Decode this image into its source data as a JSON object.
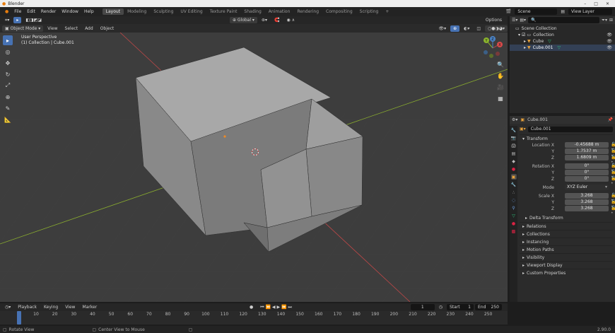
{
  "window": {
    "title": "Blender"
  },
  "menu": [
    "File",
    "Edit",
    "Render",
    "Window",
    "Help"
  ],
  "workspaces": [
    {
      "label": "Layout",
      "active": true
    },
    {
      "label": "Modeling",
      "active": false
    },
    {
      "label": "Sculpting",
      "active": false
    },
    {
      "label": "UV Editing",
      "active": false
    },
    {
      "label": "Texture Paint",
      "active": false
    },
    {
      "label": "Shading",
      "active": false
    },
    {
      "label": "Animation",
      "active": false
    },
    {
      "label": "Rendering",
      "active": false
    },
    {
      "label": "Compositing",
      "active": false
    },
    {
      "label": "Scripting",
      "active": false
    }
  ],
  "add_workspace": "+",
  "scene": "Scene",
  "view_layer": "View Layer",
  "viewport": {
    "mode": "Object Mode",
    "menus": [
      "View",
      "Select",
      "Add",
      "Object"
    ],
    "orientation": "Global",
    "info_line1": "User Perspective",
    "info_line2": "(1) Collection | Cube.001",
    "options": "Options",
    "gizmo": {
      "x": "X",
      "y": "Y",
      "z": "Z"
    }
  },
  "outliner": {
    "rows": [
      {
        "label": "Scene Collection",
        "level": 0
      },
      {
        "label": "Collection",
        "level": 1
      },
      {
        "label": "Cube",
        "level": 2
      },
      {
        "label": "Cube.001",
        "level": 2
      }
    ]
  },
  "properties": {
    "object_name": "Cube.001",
    "object_field": "Cube.001",
    "transform_label": "Transform",
    "location_label": "Location X",
    "location": [
      "-0.45688 m",
      "1.7537 m",
      "1.6809 m"
    ],
    "rotation_label": "Rotation X",
    "rotation": [
      "0°",
      "0°",
      "0°"
    ],
    "mode_label": "Mode",
    "mode_value": "XYZ Euler",
    "scale_label": "Scale X",
    "scale": [
      "3.268",
      "3.268",
      "3.268"
    ],
    "axis_y": "Y",
    "axis_z": "Z",
    "delta_transform": "Delta Transform",
    "sections": [
      "Relations",
      "Collections",
      "Instancing",
      "Motion Paths",
      "Visibility",
      "Viewport Display",
      "Custom Properties"
    ]
  },
  "timeline": {
    "menus": [
      "Playback",
      "Keying",
      "View",
      "Marker"
    ],
    "current_frame": "1",
    "start_label": "Start",
    "start": "1",
    "end_label": "End",
    "end": "250",
    "frame_labels": [
      "1",
      "10",
      "20",
      "30",
      "40",
      "50",
      "60",
      "70",
      "80",
      "90",
      "100",
      "110",
      "120",
      "130",
      "140",
      "150",
      "160",
      "170",
      "180",
      "190",
      "200",
      "210",
      "220",
      "230",
      "240",
      "250"
    ]
  },
  "status": {
    "left": "Rotate View",
    "middle": "Center View to Mouse",
    "version": "2.90.0"
  },
  "colors": {
    "accent": "#4772b3",
    "viewport_bg": "#3d3d3d",
    "x_axis": "#c04848",
    "y_axis": "#8aad2f",
    "selection": "#f08a24"
  }
}
